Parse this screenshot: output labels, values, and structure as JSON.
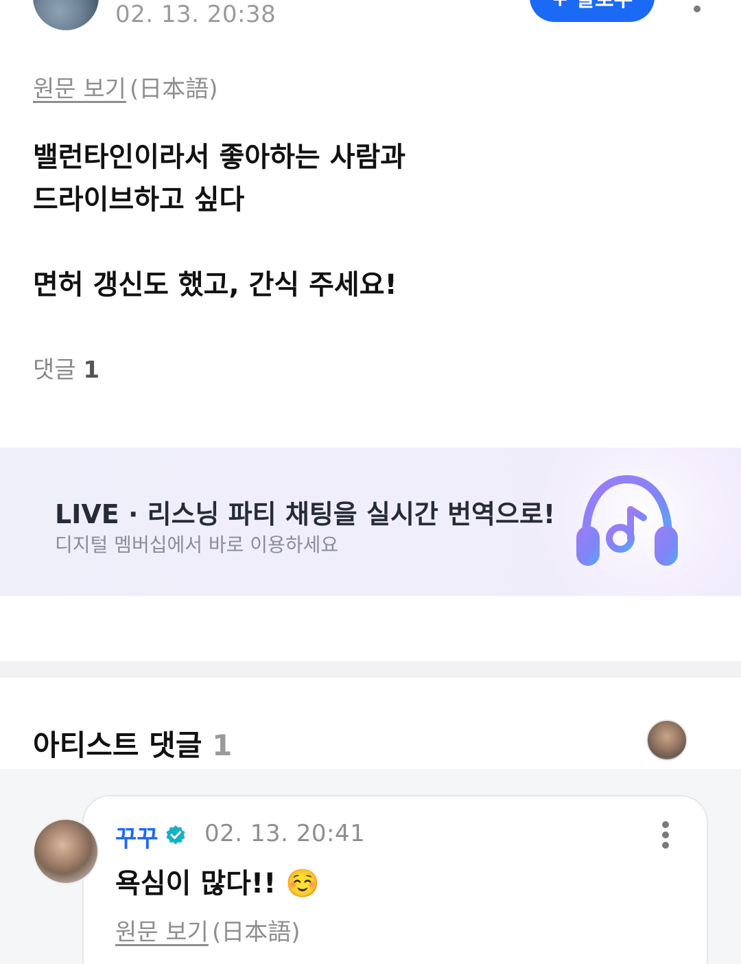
{
  "post": {
    "timestamp": "02. 13. 20:38",
    "follow_label": "+ 팔로우",
    "view_original": "원문 보기",
    "original_language": "(日本語)",
    "body": "밸런타인이라서 좋아하는 사람과\n드라이브하고 싶다\n\n면허 갱신도 했고, 간식 주세요!",
    "comments_label": "댓글",
    "comments_count": "1"
  },
  "banner": {
    "title": "LIVE · 리스닝 파티 채팅을 실시간 번역으로!",
    "subtitle": "디지털 멤버십에서 바로 이용하세요",
    "icon": "headphones-music-icon"
  },
  "artist_comments": {
    "title": "아티스트 댓글",
    "count": "1",
    "items": [
      {
        "author": "꾸꾸",
        "verified": true,
        "timestamp": "02. 13. 20:41",
        "text": "욕심이 많다!! ☺️",
        "view_original": "원문 보기",
        "original_language": "(日本語)"
      }
    ]
  },
  "colors": {
    "accent": "#1a6af5",
    "verified_badge": "#16b1c6",
    "muted_text": "#8e8e8e"
  }
}
